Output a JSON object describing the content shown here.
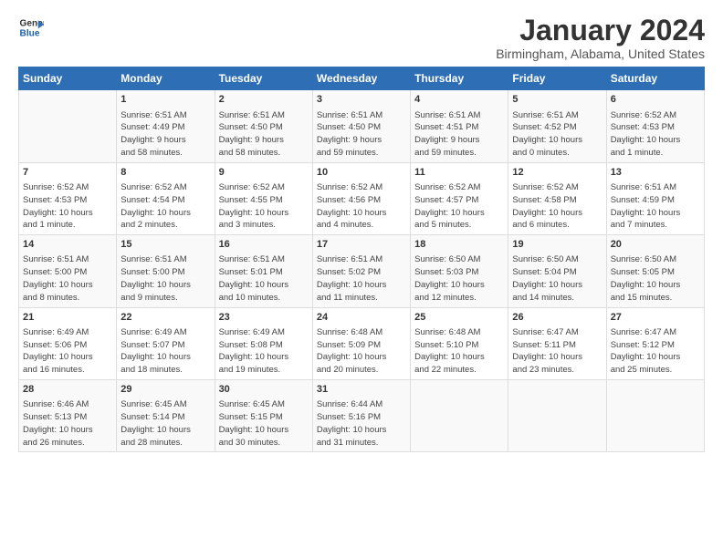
{
  "logo": {
    "line1": "General",
    "line2": "Blue"
  },
  "title": "January 2024",
  "subtitle": "Birmingham, Alabama, United States",
  "weekdays": [
    "Sunday",
    "Monday",
    "Tuesday",
    "Wednesday",
    "Thursday",
    "Friday",
    "Saturday"
  ],
  "weeks": [
    [
      {
        "day": "",
        "info": ""
      },
      {
        "day": "1",
        "info": "Sunrise: 6:51 AM\nSunset: 4:49 PM\nDaylight: 9 hours\nand 58 minutes."
      },
      {
        "day": "2",
        "info": "Sunrise: 6:51 AM\nSunset: 4:50 PM\nDaylight: 9 hours\nand 58 minutes."
      },
      {
        "day": "3",
        "info": "Sunrise: 6:51 AM\nSunset: 4:50 PM\nDaylight: 9 hours\nand 59 minutes."
      },
      {
        "day": "4",
        "info": "Sunrise: 6:51 AM\nSunset: 4:51 PM\nDaylight: 9 hours\nand 59 minutes."
      },
      {
        "day": "5",
        "info": "Sunrise: 6:51 AM\nSunset: 4:52 PM\nDaylight: 10 hours\nand 0 minutes."
      },
      {
        "day": "6",
        "info": "Sunrise: 6:52 AM\nSunset: 4:53 PM\nDaylight: 10 hours\nand 1 minute."
      }
    ],
    [
      {
        "day": "7",
        "info": "Sunrise: 6:52 AM\nSunset: 4:53 PM\nDaylight: 10 hours\nand 1 minute."
      },
      {
        "day": "8",
        "info": "Sunrise: 6:52 AM\nSunset: 4:54 PM\nDaylight: 10 hours\nand 2 minutes."
      },
      {
        "day": "9",
        "info": "Sunrise: 6:52 AM\nSunset: 4:55 PM\nDaylight: 10 hours\nand 3 minutes."
      },
      {
        "day": "10",
        "info": "Sunrise: 6:52 AM\nSunset: 4:56 PM\nDaylight: 10 hours\nand 4 minutes."
      },
      {
        "day": "11",
        "info": "Sunrise: 6:52 AM\nSunset: 4:57 PM\nDaylight: 10 hours\nand 5 minutes."
      },
      {
        "day": "12",
        "info": "Sunrise: 6:52 AM\nSunset: 4:58 PM\nDaylight: 10 hours\nand 6 minutes."
      },
      {
        "day": "13",
        "info": "Sunrise: 6:51 AM\nSunset: 4:59 PM\nDaylight: 10 hours\nand 7 minutes."
      }
    ],
    [
      {
        "day": "14",
        "info": "Sunrise: 6:51 AM\nSunset: 5:00 PM\nDaylight: 10 hours\nand 8 minutes."
      },
      {
        "day": "15",
        "info": "Sunrise: 6:51 AM\nSunset: 5:00 PM\nDaylight: 10 hours\nand 9 minutes."
      },
      {
        "day": "16",
        "info": "Sunrise: 6:51 AM\nSunset: 5:01 PM\nDaylight: 10 hours\nand 10 minutes."
      },
      {
        "day": "17",
        "info": "Sunrise: 6:51 AM\nSunset: 5:02 PM\nDaylight: 10 hours\nand 11 minutes."
      },
      {
        "day": "18",
        "info": "Sunrise: 6:50 AM\nSunset: 5:03 PM\nDaylight: 10 hours\nand 12 minutes."
      },
      {
        "day": "19",
        "info": "Sunrise: 6:50 AM\nSunset: 5:04 PM\nDaylight: 10 hours\nand 14 minutes."
      },
      {
        "day": "20",
        "info": "Sunrise: 6:50 AM\nSunset: 5:05 PM\nDaylight: 10 hours\nand 15 minutes."
      }
    ],
    [
      {
        "day": "21",
        "info": "Sunrise: 6:49 AM\nSunset: 5:06 PM\nDaylight: 10 hours\nand 16 minutes."
      },
      {
        "day": "22",
        "info": "Sunrise: 6:49 AM\nSunset: 5:07 PM\nDaylight: 10 hours\nand 18 minutes."
      },
      {
        "day": "23",
        "info": "Sunrise: 6:49 AM\nSunset: 5:08 PM\nDaylight: 10 hours\nand 19 minutes."
      },
      {
        "day": "24",
        "info": "Sunrise: 6:48 AM\nSunset: 5:09 PM\nDaylight: 10 hours\nand 20 minutes."
      },
      {
        "day": "25",
        "info": "Sunrise: 6:48 AM\nSunset: 5:10 PM\nDaylight: 10 hours\nand 22 minutes."
      },
      {
        "day": "26",
        "info": "Sunrise: 6:47 AM\nSunset: 5:11 PM\nDaylight: 10 hours\nand 23 minutes."
      },
      {
        "day": "27",
        "info": "Sunrise: 6:47 AM\nSunset: 5:12 PM\nDaylight: 10 hours\nand 25 minutes."
      }
    ],
    [
      {
        "day": "28",
        "info": "Sunrise: 6:46 AM\nSunset: 5:13 PM\nDaylight: 10 hours\nand 26 minutes."
      },
      {
        "day": "29",
        "info": "Sunrise: 6:45 AM\nSunset: 5:14 PM\nDaylight: 10 hours\nand 28 minutes."
      },
      {
        "day": "30",
        "info": "Sunrise: 6:45 AM\nSunset: 5:15 PM\nDaylight: 10 hours\nand 30 minutes."
      },
      {
        "day": "31",
        "info": "Sunrise: 6:44 AM\nSunset: 5:16 PM\nDaylight: 10 hours\nand 31 minutes."
      },
      {
        "day": "",
        "info": ""
      },
      {
        "day": "",
        "info": ""
      },
      {
        "day": "",
        "info": ""
      }
    ]
  ]
}
